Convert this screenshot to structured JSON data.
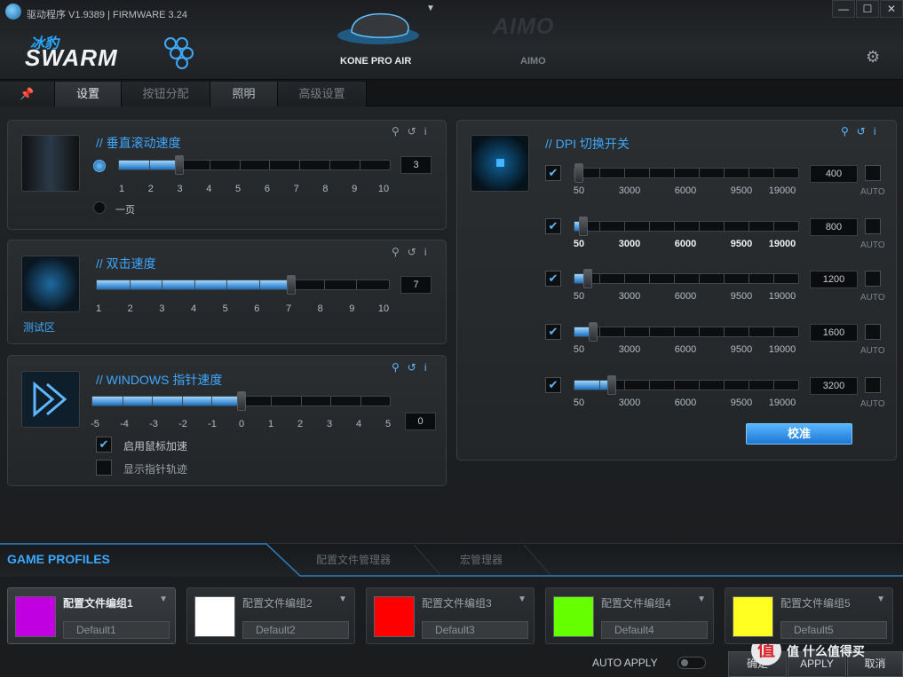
{
  "titlebar": {
    "title": "驱动程序 V1.9389 | FIRMWARE 3.24",
    "win": [
      "—",
      "☐",
      "✕"
    ]
  },
  "brand": {
    "cn": "冰豹",
    "name": "SWARM"
  },
  "devices": [
    {
      "name": "KONE PRO AIR"
    },
    {
      "name": "AIMO",
      "logo": "AIMO"
    }
  ],
  "tabs": [
    "设置",
    "按钮分配",
    "照明",
    "高级设置"
  ],
  "scroll": {
    "title": "// 垂直滚动速度",
    "scale": [
      "1",
      "2",
      "3",
      "4",
      "5",
      "6",
      "7",
      "8",
      "9",
      "10"
    ],
    "value": "3",
    "fraction": 0.222,
    "page_option": "一页",
    "selected": "lines"
  },
  "dblclick": {
    "title": "// 双击速度",
    "scale": [
      "1",
      "2",
      "3",
      "4",
      "5",
      "6",
      "7",
      "8",
      "9",
      "10"
    ],
    "value": "7",
    "fraction": 0.667,
    "test_label": "测试区"
  },
  "pointer": {
    "title": "// WINDOWS 指针速度",
    "scale": [
      "-5",
      "-4",
      "-3",
      "-2",
      "-1",
      "0",
      "1",
      "2",
      "3",
      "4",
      "5"
    ],
    "value": "0",
    "fraction": 0.5,
    "accel_label": "启用鼠标加速",
    "accel_checked": true,
    "trail_label": "显示指针轨迹",
    "trail_checked": false
  },
  "dpi": {
    "title": "// DPI 切换开关",
    "scale": [
      "50",
      "3000",
      "6000",
      "9500",
      "19000"
    ],
    "auto": "AUTO",
    "calibrate": "校准",
    "levels": [
      {
        "value": "400",
        "enabled": true,
        "fraction": 0.018
      },
      {
        "value": "800",
        "enabled": true,
        "fraction": 0.039
      },
      {
        "value": "1200",
        "enabled": true,
        "fraction": 0.061
      },
      {
        "value": "1600",
        "enabled": true,
        "fraction": 0.082
      },
      {
        "value": "3200",
        "enabled": true,
        "fraction": 0.166
      }
    ]
  },
  "profiles": {
    "title": "GAME PROFILES",
    "tabs": [
      "配置文件管理器",
      "宏管理器"
    ],
    "items": [
      {
        "name": "配置文件编组1",
        "default": "Default1",
        "color": "#c000e0",
        "active": true
      },
      {
        "name": "配置文件编组2",
        "default": "Default2",
        "color": "#ffffff",
        "active": false
      },
      {
        "name": "配置文件编组3",
        "default": "Default3",
        "color": "#ff0000",
        "active": false
      },
      {
        "name": "配置文件编组4",
        "default": "Default4",
        "color": "#66ff00",
        "active": false
      },
      {
        "name": "配置文件编组5",
        "default": "Default5",
        "color": "#ffff22",
        "active": false
      }
    ]
  },
  "footer": {
    "auto_apply": "AUTO APPLY",
    "ok": "确定",
    "apply": "APPLY",
    "cancel": "取消"
  },
  "watermark": "值 什么值得买"
}
